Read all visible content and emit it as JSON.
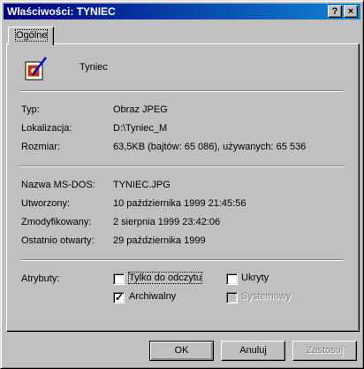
{
  "window": {
    "title": "Właściwości: TYNIEC",
    "help_glyph": "?",
    "close_glyph": "×"
  },
  "tab": {
    "label": "Ogólne"
  },
  "file": {
    "name": "Tyniec",
    "icon": "jpeg-image-file-icon"
  },
  "info": {
    "type_label": "Typ:",
    "type_value": "Obraz JPEG",
    "location_label": "Lokalizacja:",
    "location_value": "D:\\Tyniec_M",
    "size_label": "Rozmiar:",
    "size_value": "63,5KB (bajtów: 65 086), używanych: 65 536"
  },
  "details": {
    "msdos_label": "Nazwa MS-DOS:",
    "msdos_value": "TYNIEC.JPG",
    "created_label": "Utworzony:",
    "created_value": "10 października 1999 21:45:56",
    "modified_label": "Zmodyfikowany:",
    "modified_value": "2 sierpnia 1999 23:42:06",
    "accessed_label": "Ostatnio otwarty:",
    "accessed_value": "29 października 1999"
  },
  "attributes": {
    "label": "Atrybuty:",
    "readonly": {
      "label": "Tylko do odczytu",
      "checked": false
    },
    "hidden": {
      "label": "Ukryty",
      "checked": false
    },
    "archive": {
      "label": "Archiwalny",
      "checked": true
    },
    "system": {
      "label": "Systemowy",
      "checked": false,
      "disabled": true
    }
  },
  "buttons": {
    "ok": "OK",
    "cancel": "Anuluj",
    "apply": "Zastosuj"
  }
}
